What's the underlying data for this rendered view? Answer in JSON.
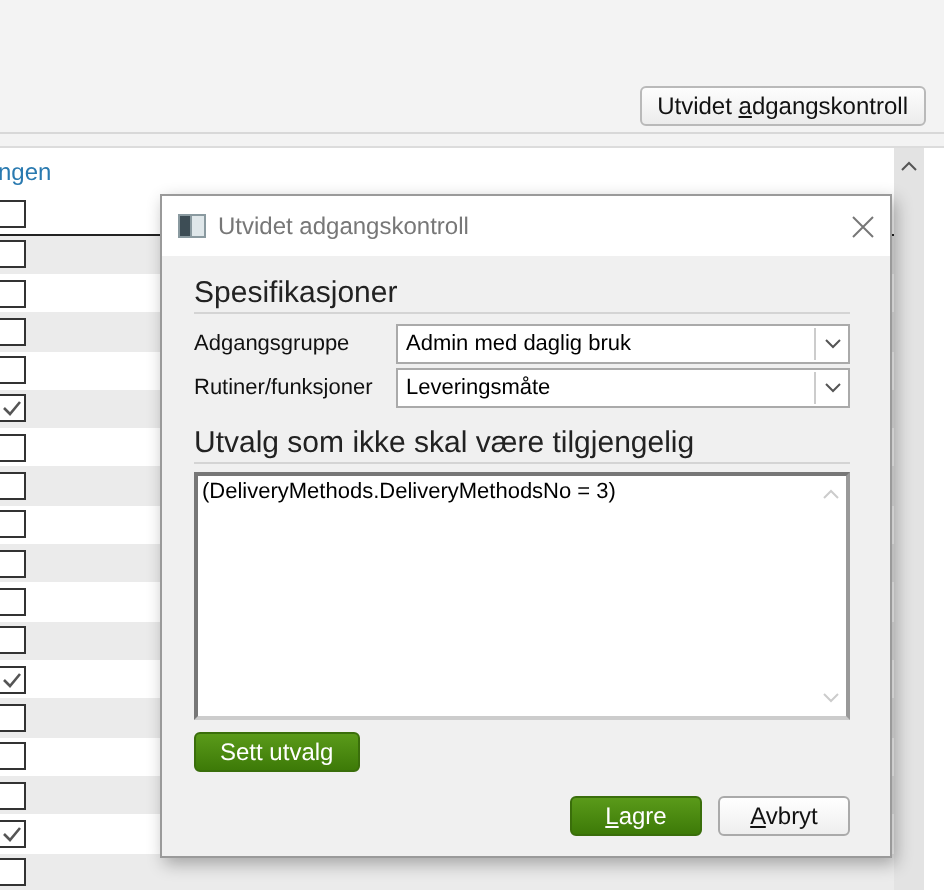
{
  "toolbar": {
    "button": {
      "before": "Utvidet ",
      "key": "a",
      "after": "dgangskontroll"
    }
  },
  "list": {
    "link": "ngen",
    "header_checked": false,
    "rows": [
      {
        "checked": false
      },
      {
        "checked": false
      },
      {
        "checked": false
      },
      {
        "checked": false
      },
      {
        "checked": true
      },
      {
        "checked": false
      },
      {
        "checked": false
      },
      {
        "checked": false
      },
      {
        "checked": false
      },
      {
        "checked": false
      },
      {
        "checked": false
      },
      {
        "checked": true
      },
      {
        "checked": false
      },
      {
        "checked": false
      },
      {
        "checked": false
      },
      {
        "checked": true
      },
      {
        "checked": false
      }
    ]
  },
  "dialog": {
    "title": "Utvidet adgangskontroll",
    "section1": "Spesifikasjoner",
    "fields": [
      {
        "label": "Adgangsgruppe",
        "value": "Admin med daglig bruk"
      },
      {
        "label": "Rutiner/funksjoner",
        "value": "Leveringsmåte"
      }
    ],
    "section2": "Utvalg som ikke skal være tilgjengelig",
    "filter": "(DeliveryMethods.DeliveryMethodsNo = 3)",
    "set_button": "Sett utvalg",
    "buttons": [
      {
        "kind": "primary",
        "key": "L",
        "after": "agre"
      },
      {
        "kind": "secondary",
        "key": "A",
        "after": "vbryt"
      }
    ]
  }
}
